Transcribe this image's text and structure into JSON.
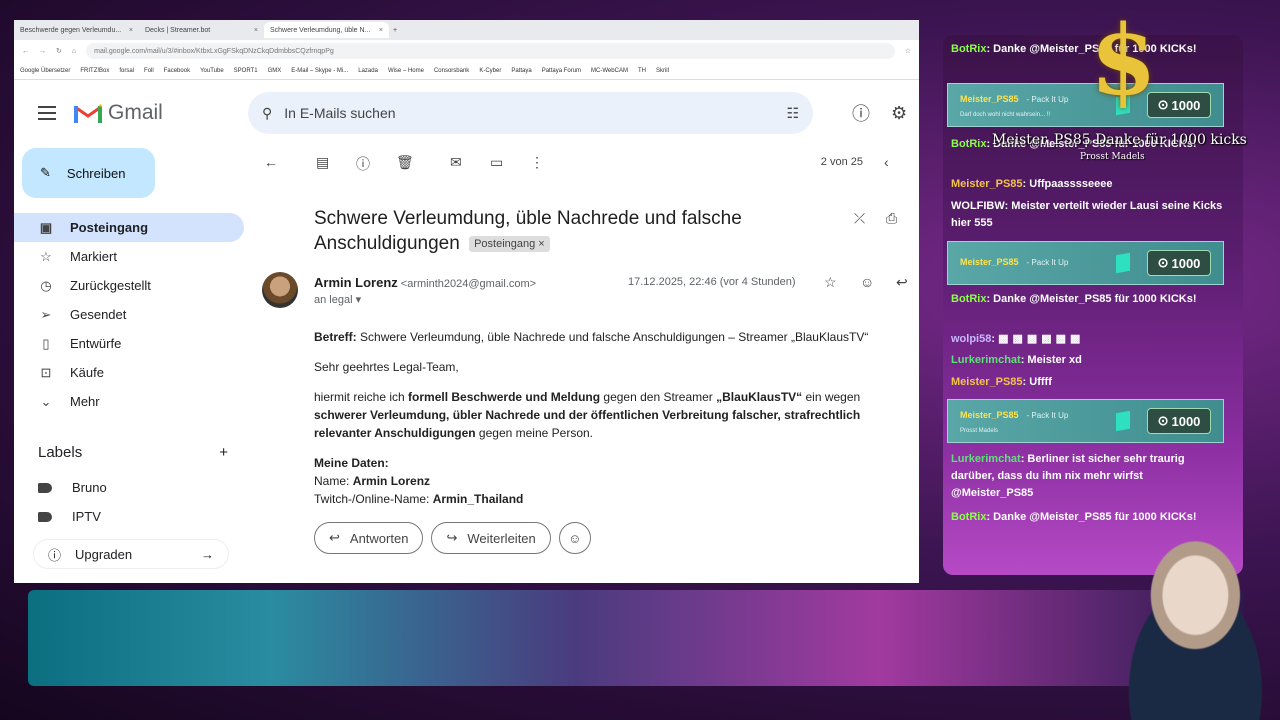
{
  "browser": {
    "tabs": [
      {
        "label": "Beschwerde gegen Verleumdu..."
      },
      {
        "label": "Decks | Streamer.bot"
      },
      {
        "label": "Schwere Verleumdung, üble N..."
      }
    ],
    "url": "mail.google.com/mail/u/3/#inbox/KtbxLxGgFSkqDNzCkqDdmbbsCQzfrnqpPg",
    "bookmarks": [
      "Google Übersetzer",
      "FRITZ!Box",
      "forsal",
      "Foll",
      "Facebook",
      "YouTube",
      "SPORT1",
      "GMX",
      "E-Mail – Skype - Mi...",
      "Lazada",
      "Wise – Home",
      "Consorsbank",
      "K-Cyber",
      "Pattaya",
      "Pattaya Forum",
      "MC-WebCAM",
      "TH",
      "Skrill"
    ]
  },
  "gmail": {
    "logo_text": "Gmail",
    "search_placeholder": "In E-Mails suchen",
    "compose_label": "Schreiben",
    "nav": [
      {
        "label": "Posteingang",
        "icon": "inbox-icon",
        "active": true
      },
      {
        "label": "Markiert",
        "icon": "star-icon"
      },
      {
        "label": "Zurückgestellt",
        "icon": "clock-icon"
      },
      {
        "label": "Gesendet",
        "icon": "send-icon"
      },
      {
        "label": "Entwürfe",
        "icon": "draft-icon"
      },
      {
        "label": "Käufe",
        "icon": "shopping-bag-icon"
      },
      {
        "label": "Mehr",
        "icon": "chevron-down-icon"
      }
    ],
    "labels_heading": "Labels",
    "labels": [
      "Bruno",
      "IPTV"
    ],
    "upgrade_label": "Upgraden",
    "pager": "2 von 25",
    "subject": "Schwere Verleumdung, üble Nachrede und falsche Anschuldigungen",
    "subject_badge": "Posteingang",
    "sender_name": "Armin Lorenz",
    "sender_email": "<arminth2024@gmail.com>",
    "to_line": "an legal",
    "date": "17.12.2025, 22:46 (vor 4 Stunden)",
    "body": {
      "betreff_label": "Betreff:",
      "betreff_text": "Schwere Verleumdung, üble Nachrede und falsche Anschuldigungen – Streamer „BlauKlausTV“",
      "greeting": "Sehr geehrtes Legal-Team,",
      "p1_a": "hiermit reiche ich ",
      "p1_b": "formell Beschwerde und Meldung",
      "p1_c": " gegen den Streamer ",
      "p1_d": "„BlauKlausTV“",
      "p1_e": " ein wegen ",
      "p1_f": "schwerer Verleumdung, übler Nachrede und der öffentlichen Verbreitung falscher, strafrechtlich relevanter Anschuldigungen",
      "p1_g": " gegen meine Person.",
      "data_heading": "Meine Daten:",
      "name_label": "Name: ",
      "name_value": "Armin Lorenz",
      "twitch_label": "Twitch-/Online-Name: ",
      "twitch_value": "Armin_Thailand"
    },
    "reply_label": "Antworten",
    "forward_label": "Weiterleiten"
  },
  "stream": {
    "overlay_title": "Meister_PS85 Danke für 1000 kicks",
    "overlay_sub": "Prosst Madels",
    "chat": [
      {
        "user": "BotRix",
        "text": ": Danke @Meister_PS85 für 1000 KICKs!"
      },
      {
        "user": "BotRix",
        "text": ": Danke @Meister_PS85 für 1000 KICKs!"
      },
      {
        "user": "Meister_PS85",
        "text": ": Uffpaasssseeee"
      },
      {
        "user": "WOLFIBW",
        "text": ": Meister verteilt wieder Lausi seine Kicks hier 555"
      },
      {
        "user": "BotRix",
        "text": ": Danke @Meister_PS85 für 1000 KICKs!"
      },
      {
        "user": "wolpi58",
        "text": ": "
      },
      {
        "user": "Lurkerimchat",
        "text": ": Meister xd"
      },
      {
        "user": "Meister_PS85",
        "text": ": Uffff"
      },
      {
        "user": "Lurkerimchat",
        "text": ": Berliner ist sicher sehr traurig darüber, dass du ihm nix mehr wirfst @Meister_PS85"
      },
      {
        "user": "BotRix",
        "text": ": Danke @Meister_PS85 für 1000 KICKs!"
      }
    ],
    "kicks": [
      {
        "user": "Meister_PS85",
        "tag": "- Pack It Up",
        "sub": "Darf doch wohl nicht wahrsein... !!",
        "amount": "1000"
      },
      {
        "user": "Meister_PS85",
        "tag": "- Pack It Up",
        "sub": "",
        "amount": "1000"
      },
      {
        "user": "Meister_PS85",
        "tag": "- Pack It Up",
        "sub": "Prosst Madels",
        "amount": "1000"
      }
    ]
  }
}
